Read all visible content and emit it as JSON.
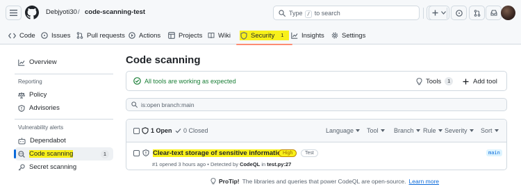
{
  "header": {
    "owner": "Debjyoti30",
    "separator": "/",
    "repo": "code-scanning-test",
    "search": {
      "prefix": "Type",
      "key": "/",
      "suffix": "to search"
    }
  },
  "tabs": [
    {
      "label": "Code",
      "icon": "code-icon"
    },
    {
      "label": "Issues",
      "icon": "issue-opened-icon"
    },
    {
      "label": "Pull requests",
      "icon": "git-pull-request-icon"
    },
    {
      "label": "Actions",
      "icon": "play-icon"
    },
    {
      "label": "Projects",
      "icon": "table-icon"
    },
    {
      "label": "Wiki",
      "icon": "book-icon"
    },
    {
      "label": "Security",
      "icon": "shield-icon",
      "count": "1",
      "active": true
    },
    {
      "label": "Insights",
      "icon": "graph-icon"
    },
    {
      "label": "Settings",
      "icon": "gear-icon"
    }
  ],
  "sidebar": {
    "overview": "Overview",
    "reporting_heading": "Reporting",
    "reporting": [
      "Policy",
      "Advisories"
    ],
    "alerts_heading": "Vulnerability alerts",
    "alerts": [
      {
        "label": "Dependabot"
      },
      {
        "label": "Code scanning",
        "count": "1",
        "selected": true
      },
      {
        "label": "Secret scanning"
      }
    ]
  },
  "main": {
    "title": "Code scanning",
    "status_message": "All tools are working as expected",
    "tools_label": "Tools",
    "tools_count": "1",
    "add_tool_label": "Add tool",
    "filter_value": "is:open branch:main",
    "list": {
      "open_label": "1 Open",
      "closed_label": "0 Closed",
      "sorters": [
        "Language",
        "Tool",
        "Branch",
        "Rule",
        "Severity",
        "Sort"
      ],
      "alerts": [
        {
          "title": "Clear-text storage of sensitive information",
          "severity": "High",
          "tag": "Test",
          "meta_prefix": "#1 opened 3 hours ago • Detected by",
          "tool": "CodeQL",
          "meta_in": "in",
          "location": "test.py:27",
          "branch": "main"
        }
      ]
    }
  },
  "footer": {
    "protip_label": "ProTip!",
    "protip_text": "The libraries and queries that power CodeQL are open-source.",
    "link": "Learn more"
  },
  "colors": {
    "accent": "#0969da",
    "success": "#1a7f37",
    "highlight": "#f8f01a",
    "active_tab_underline": "#fd8c73"
  }
}
